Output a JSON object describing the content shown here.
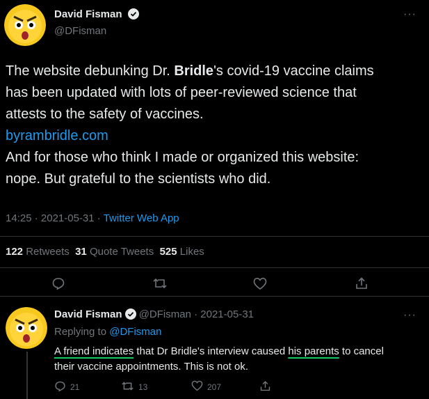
{
  "main_tweet": {
    "author_name": "David Fisman",
    "handle": "@DFisman",
    "text_line1_pre": "The website debunking Dr. ",
    "text_line1_bold": "Bridle",
    "text_line1_post": "'s covid-19 vaccine claims",
    "text_line2": "has been updated with lots of peer-reviewed science that",
    "text_line3": "attests to the safety of vaccines.",
    "link": "byrambridle.com",
    "text_line4": "And for those who think I made or organized this website:",
    "text_line5": "nope.  But grateful to the scientists who did.",
    "time": "14:25",
    "date": "2021-05-31",
    "source": "Twitter Web App",
    "retweets_count": "122",
    "retweets_label": "Retweets",
    "quote_count": "31",
    "quote_label": "Quote Tweets",
    "likes_count": "525",
    "likes_label": "Likes"
  },
  "reply": {
    "author_name": "David Fisman",
    "handle": "@DFisman",
    "date": "2021-05-31",
    "replying_label": "Replying to",
    "replying_handle": "@DFisman",
    "text_u1": "A friend indicates",
    "text_mid": " that Dr Bridle's interview caused ",
    "text_u2": "his parents",
    "text_end": " to cancel",
    "text_line2": "their vaccine appointments.  This is not ok.",
    "reply_count": "21",
    "retweet_count": "13",
    "like_count": "207"
  },
  "colors": {
    "accent": "#1d9bf0",
    "highlight_underline": "#17c964",
    "muted": "#71767b"
  },
  "icons": [
    "verified-badge-icon",
    "more-icon",
    "reply-icon",
    "retweet-icon",
    "like-icon",
    "share-icon"
  ]
}
